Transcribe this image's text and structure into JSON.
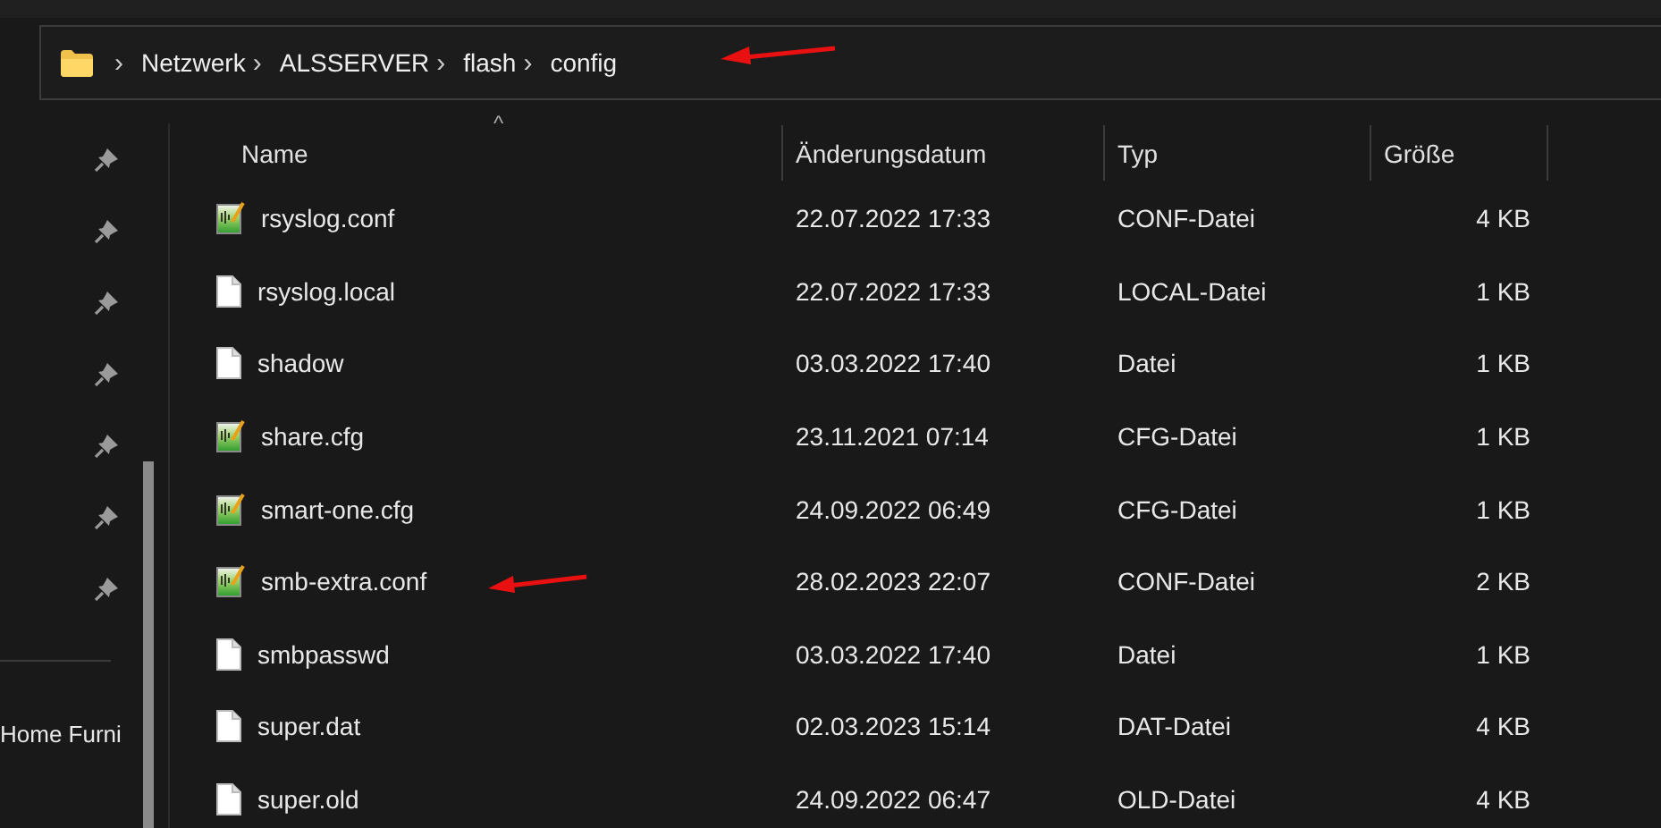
{
  "address_bar": {
    "annotated": true,
    "path": [
      {
        "label": "Netzwerk"
      },
      {
        "label": "ALSSERVER"
      },
      {
        "label": "flash"
      },
      {
        "label": "config"
      }
    ],
    "separator": "›"
  },
  "sidebar": {
    "pinned_items": [
      {
        "pinned": true
      },
      {
        "pinned": true
      },
      {
        "pinned": true
      },
      {
        "pinned": true
      },
      {
        "pinned": true
      },
      {
        "pinned": true
      },
      {
        "pinned": true
      }
    ],
    "items": [
      {
        "label": "Home Furni"
      }
    ]
  },
  "table": {
    "sort_indicator": "^",
    "columns": [
      "Name",
      "Änderungsdatum",
      "Typ",
      "Größe"
    ],
    "rows": [
      {
        "kind": "notepad",
        "name": "rsyslog.conf",
        "date": "22.07.2022 17:33",
        "type": "CONF-Datei",
        "size": "4 KB",
        "annotated": false
      },
      {
        "kind": "blank",
        "name": "rsyslog.local",
        "date": "22.07.2022 17:33",
        "type": "LOCAL-Datei",
        "size": "1 KB",
        "annotated": false
      },
      {
        "kind": "blank",
        "name": "shadow",
        "date": "03.03.2022 17:40",
        "type": "Datei",
        "size": "1 KB",
        "annotated": false
      },
      {
        "kind": "notepad",
        "name": "share.cfg",
        "date": "23.11.2021 07:14",
        "type": "CFG-Datei",
        "size": "1 KB",
        "annotated": false
      },
      {
        "kind": "notepad",
        "name": "smart-one.cfg",
        "date": "24.09.2022 06:49",
        "type": "CFG-Datei",
        "size": "1 KB",
        "annotated": false
      },
      {
        "kind": "notepad",
        "name": "smb-extra.conf",
        "date": "28.02.2023 22:07",
        "type": "CONF-Datei",
        "size": "2 KB",
        "annotated": true
      },
      {
        "kind": "blank",
        "name": "smbpasswd",
        "date": "03.03.2022 17:40",
        "type": "Datei",
        "size": "1 KB",
        "annotated": false
      },
      {
        "kind": "blank",
        "name": "super.dat",
        "date": "02.03.2023 15:14",
        "type": "DAT-Datei",
        "size": "4 KB",
        "annotated": false
      },
      {
        "kind": "blank",
        "name": "super.old",
        "date": "24.09.2022 06:47",
        "type": "OLD-Datei",
        "size": "4 KB",
        "annotated": false
      }
    ]
  }
}
